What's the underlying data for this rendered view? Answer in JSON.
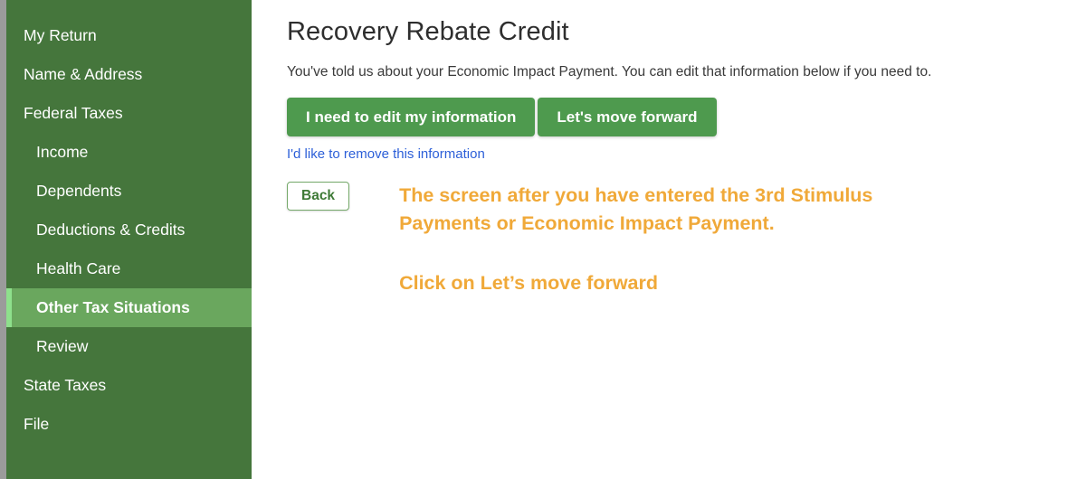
{
  "sidebar": {
    "items": [
      {
        "label": "My Return",
        "level": 0,
        "active": false
      },
      {
        "label": "Name & Address",
        "level": 0,
        "active": false
      },
      {
        "label": "Federal Taxes",
        "level": 0,
        "active": false
      },
      {
        "label": "Income",
        "level": 1,
        "active": false
      },
      {
        "label": "Dependents",
        "level": 1,
        "active": false
      },
      {
        "label": "Deductions & Credits",
        "level": 1,
        "active": false
      },
      {
        "label": "Health Care",
        "level": 1,
        "active": false
      },
      {
        "label": "Other Tax Situations",
        "level": 1,
        "active": true
      },
      {
        "label": "Review",
        "level": 1,
        "active": false
      },
      {
        "label": "State Taxes",
        "level": 0,
        "active": false
      },
      {
        "label": "File",
        "level": 0,
        "active": false
      }
    ]
  },
  "main": {
    "title": "Recovery Rebate Credit",
    "subtitle": "You've told us about your Economic Impact Payment. You can edit that information below if you need to.",
    "buttons": {
      "edit_label": "I need to edit my information",
      "forward_label": "Let's move forward",
      "back_label": "Back"
    },
    "remove_link": "I'd like to remove this information",
    "annotation": {
      "line1": "The screen after you have entered the 3rd Stimulus Payments or Economic Impact Payment.",
      "line2": "Click on Let’s move forward"
    }
  },
  "colors": {
    "sidebar_bg": "#45763c",
    "sidebar_active_bg": "#6aa75e",
    "sidebar_accent": "#8ee08c",
    "button_green": "#4e9a4e",
    "link_blue": "#2c5fd8",
    "annotation_orange": "#f0a939",
    "back_button_text": "#3e7a36"
  }
}
